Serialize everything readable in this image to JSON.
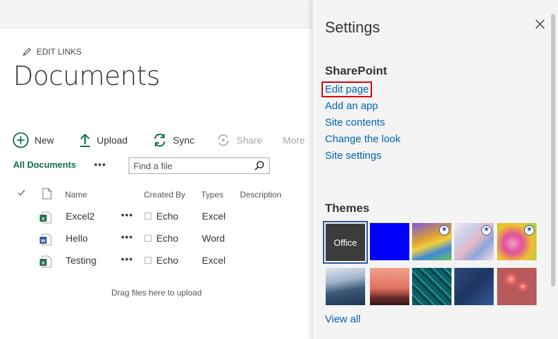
{
  "main": {
    "edit_links": "EDIT LINKS",
    "title": "Documents",
    "commands": {
      "new": "New",
      "upload": "Upload",
      "sync": "Sync",
      "share": "Share",
      "more": "More"
    },
    "view_name": "All Documents",
    "view_more": "•••",
    "search_placeholder": "Find a file",
    "columns": {
      "name": "Name",
      "created_by": "Created By",
      "types": "Types",
      "description": "Description"
    },
    "rows": [
      {
        "name": "Excel2",
        "actions": "•••",
        "created_by": "Echo",
        "type": "Excel",
        "icon": "excel-file-icon"
      },
      {
        "name": "Hello",
        "actions": "•••",
        "created_by": "Echo",
        "type": "Word",
        "icon": "word-file-icon"
      },
      {
        "name": "Testing",
        "actions": "•••",
        "created_by": "Echo",
        "type": "Excel",
        "icon": "excel-file-icon"
      }
    ],
    "drag_hint": "Drag files here to upload"
  },
  "settings": {
    "title": "Settings",
    "sharepoint_heading": "SharePoint",
    "links": [
      "Edit page",
      "Add an app",
      "Site contents",
      "Change the look",
      "Site settings"
    ],
    "highlighted_link": "Edit page",
    "themes_heading": "Themes",
    "office_theme_label": "Office",
    "view_all": "View all"
  },
  "colors": {
    "accent_green": "#0f6e4c",
    "link_blue": "#0063b1",
    "highlight_red": "#e00000",
    "panel_bg": "#f4f4f4"
  }
}
